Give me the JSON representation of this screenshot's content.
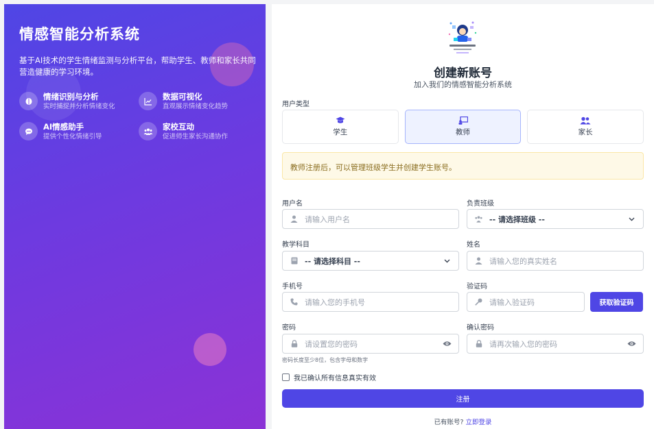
{
  "left": {
    "brand": "情感智能分析系统",
    "tagline": "基于AI技术的学生情绪监测与分析平台，帮助学生、教师和家长共同营造健康的学习环境。",
    "features": [
      {
        "icon": "brain-icon",
        "title": "情绪识别与分析",
        "desc": "实时捕捉并分析情绪变化"
      },
      {
        "icon": "chart-line-icon",
        "title": "数据可视化",
        "desc": "直观展示情绪变化趋势"
      },
      {
        "icon": "chat-bubble-icon",
        "title": "AI情感助手",
        "desc": "提供个性化情绪引导"
      },
      {
        "icon": "users-icon",
        "title": "家校互动",
        "desc": "促进师生家长沟通协作"
      }
    ]
  },
  "form": {
    "title": "创建新账号",
    "subtitle": "加入我们的情感智能分析系统",
    "user_type_label": "用户类型",
    "user_types": [
      {
        "label": "学生",
        "icon": "graduation-cap-icon",
        "selected": false
      },
      {
        "label": "教师",
        "icon": "chalkboard-teacher-icon",
        "selected": true
      },
      {
        "label": "家长",
        "icon": "user-friends-icon",
        "selected": false
      }
    ],
    "notice": "教师注册后，可以管理班级学生并创建学生账号。",
    "username": {
      "label": "用户名",
      "placeholder": "请输入用户名"
    },
    "class": {
      "label": "负责班级",
      "value": "-- 请选择班级 --"
    },
    "subject": {
      "label": "教学科目",
      "value": "-- 请选择科目 --"
    },
    "realname": {
      "label": "姓名",
      "placeholder": "请输入您的真实姓名"
    },
    "phone": {
      "label": "手机号",
      "placeholder": "请输入您的手机号"
    },
    "code": {
      "label": "验证码",
      "placeholder": "请输入验证码",
      "button": "获取验证码"
    },
    "password": {
      "label": "密码",
      "placeholder": "请设置您的密码",
      "hint": "密码长度至少8位，包含字母和数字"
    },
    "confirm": {
      "label": "确认密码",
      "placeholder": "请再次输入您的密码"
    },
    "agree": "我已确认所有信息真实有效",
    "submit": "注册",
    "login_prompt": "已有账号?",
    "login_link": "立即登录"
  },
  "colors": {
    "accent": "#4f46e5",
    "gradient_start": "#4f46e5",
    "gradient_end": "#8b32d6",
    "notice_bg": "#fef9e7"
  }
}
